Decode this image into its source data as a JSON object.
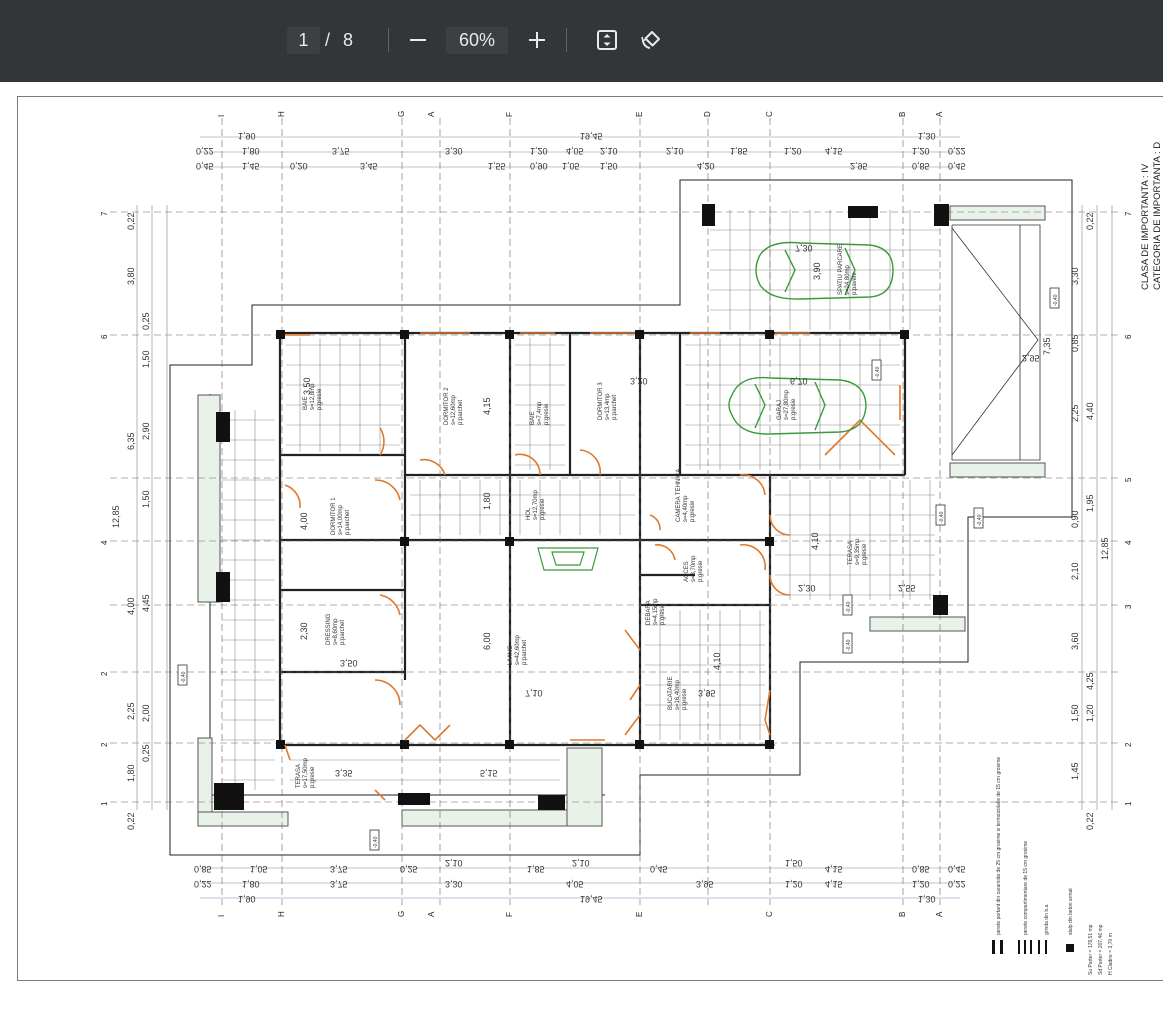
{
  "toolbar": {
    "current_page": "1",
    "page_separator": "/",
    "total_pages": "8",
    "zoom": "60%",
    "icons": [
      "minus-icon",
      "plus-icon",
      "fit-page-icon",
      "rotate-icon"
    ]
  },
  "drawing": {
    "header_line1": "CLASA DE IMPORTANTA : IV",
    "header_line2": "CATEGORIA DE IMPORTANTA : D",
    "axes_letters": [
      "I",
      "H",
      "G",
      "A",
      "F",
      "E",
      "D",
      "C",
      "B",
      "A"
    ],
    "axes_numbers": [
      "7",
      "6",
      "5",
      "4",
      "3",
      "2",
      "1"
    ],
    "top_dims": {
      "row1": [
        "1,90",
        "19,45",
        "1,30"
      ],
      "row2": [
        "0,22",
        "1,80",
        "3,75",
        "3,30",
        "1,20",
        "4,05",
        "2,10",
        "2,10",
        "1,85",
        "1,20",
        "4,15",
        "1,20",
        "0,22"
      ],
      "row3": [
        "0,45",
        "1,45",
        "0,25",
        "0,20",
        "3,45",
        "1,55",
        "0,90",
        "1,05",
        "1,50",
        "4,20",
        "2,95",
        "0,85",
        "0,45"
      ]
    },
    "bottom_dims": {
      "row1": [
        "0,85",
        "1,05",
        "3,75",
        "0,25",
        "2,10",
        "1,85",
        "2,10",
        "0,45",
        "3,95",
        "1,50",
        "4,15",
        "0,85",
        "0,45"
      ],
      "row2": [
        "0,22",
        "1,80",
        "3,75",
        "3,30",
        "4,05",
        "3,95",
        "1,20",
        "4,15",
        "1,20",
        "0,22"
      ],
      "row3": [
        "1,90",
        "19,45",
        "1,30"
      ]
    },
    "left_dims": [
      "0,22",
      "3,80",
      "0,25",
      "1,50",
      "2,90",
      "6,35",
      "1,50",
      "12,85",
      "4,00",
      "4,45",
      "2,25",
      "2,00",
      "0,25",
      "1,80",
      "0,22"
    ],
    "right_dims": [
      "0,22",
      "3,30",
      "0,85",
      "2,25",
      "4,40",
      "1,95",
      "0,90",
      "12,85",
      "2,10",
      "3,60",
      "4,25",
      "1,50",
      "1,20",
      "1,45",
      "0,22"
    ],
    "rooms": [
      {
        "name": "BAIE",
        "area": "s=12,8mp",
        "floor": "p:gresie"
      },
      {
        "name": "DORMITOR 2",
        "area": "s=12,60mp",
        "floor": "p:parchet"
      },
      {
        "name": "BAIE",
        "area": "s=7,4mp",
        "floor": "p:gresie"
      },
      {
        "name": "DORMITOR 3",
        "area": "s=13,4mp",
        "floor": "p:parchet"
      },
      {
        "name": "GARAJ",
        "area": "s=27,80mp",
        "floor": "p:gresie"
      },
      {
        "name": "SPATIU PARCARE",
        "area": "s=24,80mp",
        "floor": "p:pavele"
      },
      {
        "name": "DORMITOR 1",
        "area": "s=14,00mp",
        "floor": "p:parchet"
      },
      {
        "name": "HOL",
        "area": "s=12,70mp",
        "floor": "p:gresie"
      },
      {
        "name": "CAMERA TEHNICA",
        "area": "s=4,40mp",
        "floor": "p:gresie"
      },
      {
        "name": "ACCES",
        "area": "s=3,70mp",
        "floor": "p:gresie"
      },
      {
        "name": "TERASA",
        "area": "s=17,50mp",
        "floor": "p:gresie"
      },
      {
        "name": "DRESSING",
        "area": "s=8,60mp",
        "floor": "p:parchet"
      },
      {
        "name": "LIVING",
        "area": "s=42,60mp",
        "floor": "p:parchet"
      },
      {
        "name": "DEBARA",
        "area": "s=4,15mp",
        "floor": "p:gresie"
      },
      {
        "name": "BUCATARIE",
        "area": "s=16,40mp",
        "floor": "p:gresie"
      },
      {
        "name": "TERASA",
        "area": "s=9,35mp",
        "floor": "p:gresie"
      }
    ],
    "interior_dims": [
      "3,50",
      "4,15",
      "1,80",
      "3,20",
      "6,70",
      "4,00",
      "2,30",
      "3,50",
      "0,15",
      "6,00",
      "7,10",
      "4,10",
      "3,95",
      "4,10",
      "2,30",
      "2,55",
      "3,35",
      "5,15",
      "1,90",
      "0,60",
      "0,80",
      "2,95",
      "7,30",
      "7,35",
      "3,90",
      "1,05",
      "1,15",
      "1,75",
      "0,90",
      "0,25"
    ],
    "legend": [
      "perete portant din caramida de 25 cm grosime si termoizolatie de 15 cm grosime",
      "perete compartimentare de 15 cm grosime",
      "grinda din b.a.",
      "stalp din beton armat"
    ],
    "legend_totals": [
      "Su Parter = 178,51 mp",
      "Sd Parter = 207,46 mp",
      "H Cladire = 3,70 m"
    ],
    "level_tags": [
      "-0,40",
      "-0,40",
      "-0,40",
      "-0,40",
      "-0,40",
      "-0,40",
      "-0,40",
      "-0,40"
    ]
  }
}
